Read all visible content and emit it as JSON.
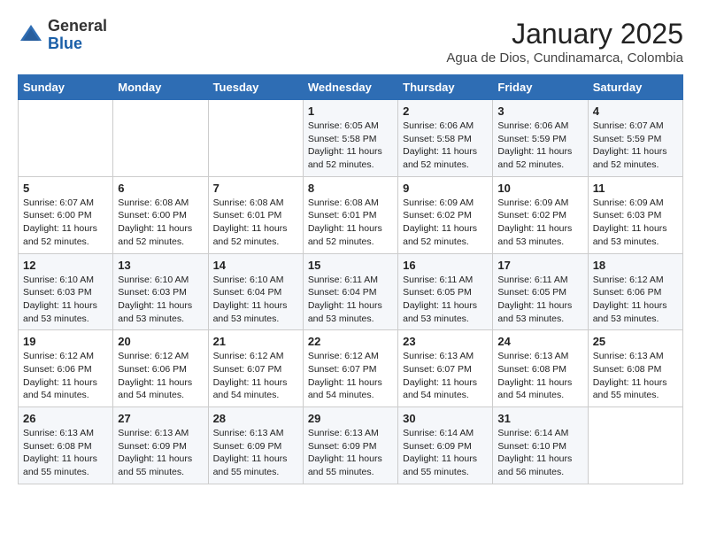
{
  "header": {
    "logo_general": "General",
    "logo_blue": "Blue",
    "month": "January 2025",
    "location": "Agua de Dios, Cundinamarca, Colombia"
  },
  "days_of_week": [
    "Sunday",
    "Monday",
    "Tuesday",
    "Wednesday",
    "Thursday",
    "Friday",
    "Saturday"
  ],
  "weeks": [
    [
      {
        "day": "",
        "info": ""
      },
      {
        "day": "",
        "info": ""
      },
      {
        "day": "",
        "info": ""
      },
      {
        "day": "1",
        "info": "Sunrise: 6:05 AM\nSunset: 5:58 PM\nDaylight: 11 hours\nand 52 minutes."
      },
      {
        "day": "2",
        "info": "Sunrise: 6:06 AM\nSunset: 5:58 PM\nDaylight: 11 hours\nand 52 minutes."
      },
      {
        "day": "3",
        "info": "Sunrise: 6:06 AM\nSunset: 5:59 PM\nDaylight: 11 hours\nand 52 minutes."
      },
      {
        "day": "4",
        "info": "Sunrise: 6:07 AM\nSunset: 5:59 PM\nDaylight: 11 hours\nand 52 minutes."
      }
    ],
    [
      {
        "day": "5",
        "info": "Sunrise: 6:07 AM\nSunset: 6:00 PM\nDaylight: 11 hours\nand 52 minutes."
      },
      {
        "day": "6",
        "info": "Sunrise: 6:08 AM\nSunset: 6:00 PM\nDaylight: 11 hours\nand 52 minutes."
      },
      {
        "day": "7",
        "info": "Sunrise: 6:08 AM\nSunset: 6:01 PM\nDaylight: 11 hours\nand 52 minutes."
      },
      {
        "day": "8",
        "info": "Sunrise: 6:08 AM\nSunset: 6:01 PM\nDaylight: 11 hours\nand 52 minutes."
      },
      {
        "day": "9",
        "info": "Sunrise: 6:09 AM\nSunset: 6:02 PM\nDaylight: 11 hours\nand 52 minutes."
      },
      {
        "day": "10",
        "info": "Sunrise: 6:09 AM\nSunset: 6:02 PM\nDaylight: 11 hours\nand 53 minutes."
      },
      {
        "day": "11",
        "info": "Sunrise: 6:09 AM\nSunset: 6:03 PM\nDaylight: 11 hours\nand 53 minutes."
      }
    ],
    [
      {
        "day": "12",
        "info": "Sunrise: 6:10 AM\nSunset: 6:03 PM\nDaylight: 11 hours\nand 53 minutes."
      },
      {
        "day": "13",
        "info": "Sunrise: 6:10 AM\nSunset: 6:03 PM\nDaylight: 11 hours\nand 53 minutes."
      },
      {
        "day": "14",
        "info": "Sunrise: 6:10 AM\nSunset: 6:04 PM\nDaylight: 11 hours\nand 53 minutes."
      },
      {
        "day": "15",
        "info": "Sunrise: 6:11 AM\nSunset: 6:04 PM\nDaylight: 11 hours\nand 53 minutes."
      },
      {
        "day": "16",
        "info": "Sunrise: 6:11 AM\nSunset: 6:05 PM\nDaylight: 11 hours\nand 53 minutes."
      },
      {
        "day": "17",
        "info": "Sunrise: 6:11 AM\nSunset: 6:05 PM\nDaylight: 11 hours\nand 53 minutes."
      },
      {
        "day": "18",
        "info": "Sunrise: 6:12 AM\nSunset: 6:06 PM\nDaylight: 11 hours\nand 53 minutes."
      }
    ],
    [
      {
        "day": "19",
        "info": "Sunrise: 6:12 AM\nSunset: 6:06 PM\nDaylight: 11 hours\nand 54 minutes."
      },
      {
        "day": "20",
        "info": "Sunrise: 6:12 AM\nSunset: 6:06 PM\nDaylight: 11 hours\nand 54 minutes."
      },
      {
        "day": "21",
        "info": "Sunrise: 6:12 AM\nSunset: 6:07 PM\nDaylight: 11 hours\nand 54 minutes."
      },
      {
        "day": "22",
        "info": "Sunrise: 6:12 AM\nSunset: 6:07 PM\nDaylight: 11 hours\nand 54 minutes."
      },
      {
        "day": "23",
        "info": "Sunrise: 6:13 AM\nSunset: 6:07 PM\nDaylight: 11 hours\nand 54 minutes."
      },
      {
        "day": "24",
        "info": "Sunrise: 6:13 AM\nSunset: 6:08 PM\nDaylight: 11 hours\nand 54 minutes."
      },
      {
        "day": "25",
        "info": "Sunrise: 6:13 AM\nSunset: 6:08 PM\nDaylight: 11 hours\nand 55 minutes."
      }
    ],
    [
      {
        "day": "26",
        "info": "Sunrise: 6:13 AM\nSunset: 6:08 PM\nDaylight: 11 hours\nand 55 minutes."
      },
      {
        "day": "27",
        "info": "Sunrise: 6:13 AM\nSunset: 6:09 PM\nDaylight: 11 hours\nand 55 minutes."
      },
      {
        "day": "28",
        "info": "Sunrise: 6:13 AM\nSunset: 6:09 PM\nDaylight: 11 hours\nand 55 minutes."
      },
      {
        "day": "29",
        "info": "Sunrise: 6:13 AM\nSunset: 6:09 PM\nDaylight: 11 hours\nand 55 minutes."
      },
      {
        "day": "30",
        "info": "Sunrise: 6:14 AM\nSunset: 6:09 PM\nDaylight: 11 hours\nand 55 minutes."
      },
      {
        "day": "31",
        "info": "Sunrise: 6:14 AM\nSunset: 6:10 PM\nDaylight: 11 hours\nand 56 minutes."
      },
      {
        "day": "",
        "info": ""
      }
    ]
  ]
}
